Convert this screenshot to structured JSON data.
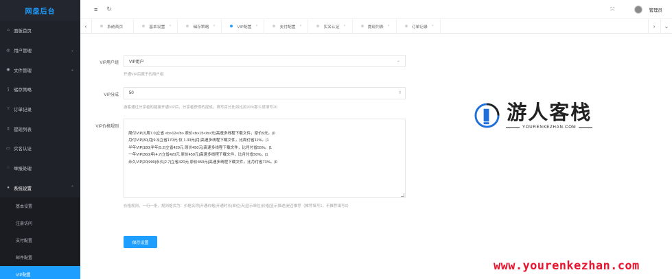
{
  "sidebar": {
    "logo": "网盘后台",
    "items": [
      {
        "icon": "home-icon",
        "glyph": "⌂",
        "label": "面板首页",
        "arrow": ""
      },
      {
        "icon": "user-icon",
        "glyph": "◎",
        "label": "用户管理",
        "arrow": "⌄"
      },
      {
        "icon": "file-icon",
        "glyph": "◉",
        "label": "文件管理",
        "arrow": "⌄"
      },
      {
        "icon": "storage-icon",
        "glyph": "⟆",
        "label": "储存策略",
        "arrow": ""
      },
      {
        "icon": "order-icon",
        "glyph": "⑂",
        "label": "订单记录",
        "arrow": ""
      },
      {
        "icon": "withdraw-icon",
        "glyph": "▯",
        "label": "提现列表",
        "arrow": ""
      },
      {
        "icon": "verify-icon",
        "glyph": "▭",
        "label": "实名认证",
        "arrow": ""
      },
      {
        "icon": "report-icon",
        "glyph": "◌",
        "label": "举报处理",
        "arrow": ""
      },
      {
        "icon": "settings-icon",
        "glyph": "●",
        "label": "系统设置",
        "arrow": "⌃"
      }
    ],
    "subitems": [
      {
        "label": "基本设置"
      },
      {
        "label": "注册访问"
      },
      {
        "label": "支付配置"
      },
      {
        "label": "邮件配置"
      },
      {
        "label": "VIP配置"
      }
    ]
  },
  "header": {
    "menu_glyph": "≡",
    "refresh_glyph": "↻",
    "fullscreen_glyph": "⤧",
    "username": "管理员"
  },
  "tabs": {
    "prev": "‹",
    "next": "›",
    "more": "⌄",
    "items": [
      {
        "label": "系统首页",
        "close": ""
      },
      {
        "label": "基本设置",
        "close": "×"
      },
      {
        "label": "储存策略",
        "close": "×"
      },
      {
        "label": "VIP配置",
        "close": "×"
      },
      {
        "label": "支付配置",
        "close": "×"
      },
      {
        "label": "实名认证",
        "close": "×"
      },
      {
        "label": "提现列表",
        "close": "×"
      },
      {
        "label": "订单记录",
        "close": "×"
      }
    ]
  },
  "form": {
    "vip_group": {
      "label": "VIP用户组",
      "value": "VIP用户",
      "hint": "开通VIP后属于的用户组"
    },
    "vip_discount": {
      "label": "VIP分成",
      "value": "50",
      "hint": "游客通过分享者的链接开通VIP后，分享者获得的提成，填写百分比如比如20%那么就填写20"
    },
    "vip_price": {
      "label": "VIP价格规则",
      "value": "周付VIP|7|周7.0|立省 <b>12</b> 原价<b>15</b>元|高速多线程下载文件，原价9元。|0\n月付VIP|30|月|9.3|立省170元 仅 1.33元|月|高速多线程下载文件，比周付省11%。|1\n半年VIP|180|半年|5.2|立省420元 原价450元|高速多线程下载文件，比月付省55%。|1\n一年VIP|360|年|4.7|立省420元 原价450元|高速多线程下载文件，比月付省50%。|1\n永久VIP|20|999|永久|2.7|立省420元 原价450元|高速多线程下载文件，比月付省73%。|0",
      "hint": "价格规则，一行一条，规则格式为：价格名称|开通价格|开通时长|单位|天|显示单位|价格|显示描述|是否推荐（推荐填写1，不推荐填写0）"
    },
    "save_label": "保存设置"
  },
  "watermark": {
    "cn": "游人客栈",
    "en": "YOURENKEZHAN.COM",
    "url": "www.yourenkezhan.com"
  },
  "colors": {
    "accent": "#1e9fff",
    "sidebar": "#20222a",
    "watermark_red": "#e8152f"
  }
}
